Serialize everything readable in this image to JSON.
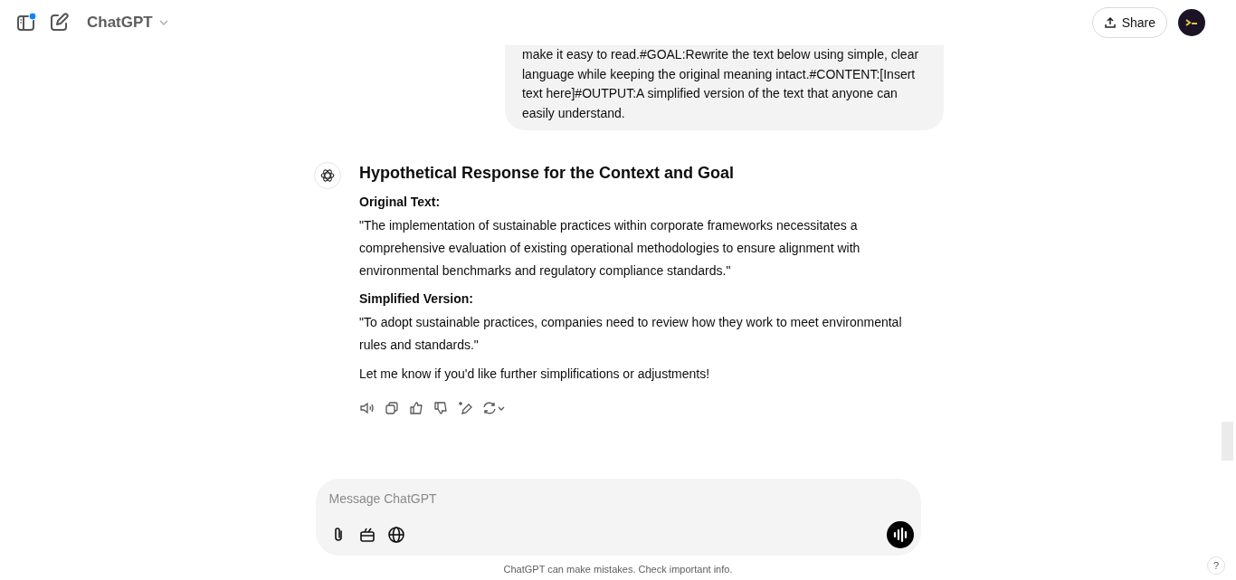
{
  "header": {
    "title": "ChatGPT",
    "sidebar_notification": true,
    "share_label": "Share"
  },
  "messages": [
    {
      "kind": "user",
      "text": "make it easy to read.#GOAL:Rewrite the text below using simple, clear language while keeping the original meaning intact.#CONTENT:[Insert text here]#OUTPUT:A simplified version of the text that anyone can easily understand."
    },
    {
      "kind": "assistant",
      "heading": "Hypothetical Response for the Context and Goal",
      "blocks": [
        {
          "kind": "label",
          "text": "Original Text:"
        },
        {
          "kind": "paragraph",
          "text": "\"The implementation of sustainable practices within corporate frameworks necessitates a comprehensive evaluation of existing operational methodologies to ensure alignment with environmental benchmarks and regulatory compliance standards.\""
        },
        {
          "kind": "label",
          "text": "Simplified Version:"
        },
        {
          "kind": "paragraph",
          "text": "\"To adopt sustainable practices, companies need to review how they work to meet environmental rules and standards.\""
        },
        {
          "kind": "paragraph",
          "text": "Let me know if you'd like further simplifications or adjustments!"
        }
      ]
    }
  ],
  "composer": {
    "placeholder": "Message ChatGPT"
  },
  "disclaimer": "ChatGPT can make mistakes. Check important info.",
  "help_label": "?"
}
